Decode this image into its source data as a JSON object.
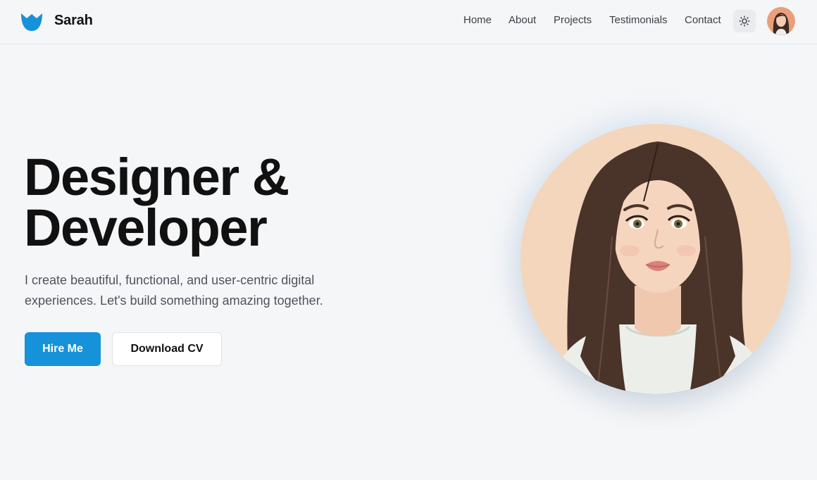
{
  "brand": {
    "name": "Sarah",
    "logo_icon": "m-wave-logo-icon",
    "accent": "#1592d9"
  },
  "nav": {
    "items": [
      {
        "label": "Home"
      },
      {
        "label": "About"
      },
      {
        "label": "Projects"
      },
      {
        "label": "Testimonials"
      },
      {
        "label": "Contact"
      }
    ],
    "theme_toggle_icon": "sun-icon",
    "avatar_icon": "user-avatar"
  },
  "hero": {
    "headline_line1": "Designer &",
    "headline_line2": "Developer",
    "subtitle": "I create beautiful, functional, and user-centric digital experiences. Let's build something amazing together.",
    "primary_button": "Hire Me",
    "secondary_button": "Download CV",
    "portrait_icon": "portrait-illustration"
  },
  "colors": {
    "background": "#f5f6f8",
    "primary": "#1592d9",
    "portrait_bg": "#f3d6bb",
    "hair": "#4a3329"
  }
}
